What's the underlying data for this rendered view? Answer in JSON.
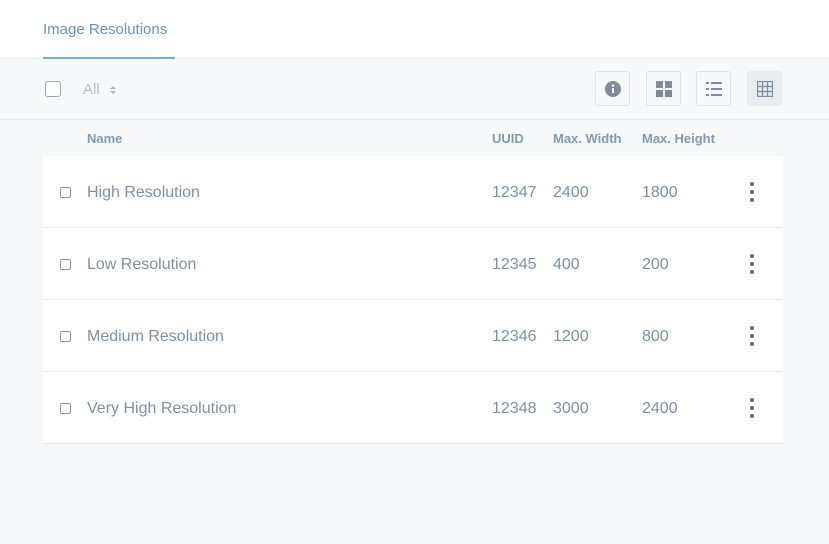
{
  "tabs": [
    {
      "label": "Image Resolutions",
      "active": true
    }
  ],
  "toolbar": {
    "filter_label": "All",
    "view_buttons": [
      {
        "icon": "info-icon",
        "active": false
      },
      {
        "icon": "grid-tiles-icon",
        "active": false
      },
      {
        "icon": "list-icon",
        "active": false
      },
      {
        "icon": "table-icon",
        "active": true
      }
    ]
  },
  "table": {
    "columns": [
      "Name",
      "UUID",
      "Max. Width",
      "Max. Height"
    ],
    "rows": [
      {
        "name": "High Resolution",
        "uuid": "12347",
        "max_width": "2400",
        "max_height": "1800"
      },
      {
        "name": "Low Resolution",
        "uuid": "12345",
        "max_width": "400",
        "max_height": "200"
      },
      {
        "name": "Medium Resolution",
        "uuid": "12346",
        "max_width": "1200",
        "max_height": "800"
      },
      {
        "name": "Very High Resolution",
        "uuid": "12348",
        "max_width": "3000",
        "max_height": "2400"
      }
    ]
  },
  "colors": {
    "accent": "#6fb0da",
    "text": "#7f8fa3",
    "background": "#f7f8f9"
  }
}
